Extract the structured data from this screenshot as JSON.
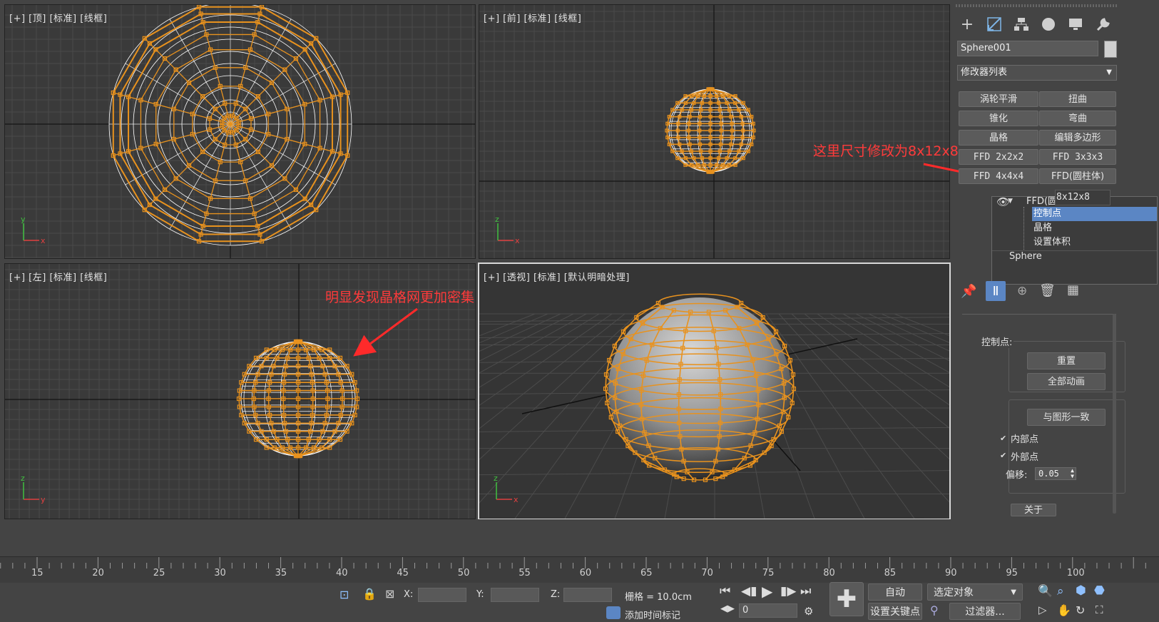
{
  "viewports": {
    "top_label": "[+] [顶] [标准] [线框]",
    "front_label": "[+] [前] [标准] [线框]",
    "left_label": "[+] [左] [标准] [线框]",
    "persp_label": "[+] [透视] [标准] [默认明暗处理]"
  },
  "annotations": {
    "size_note": "这里尺寸修改为8x12x8",
    "dense_note": "明显发现晶格网更加密集"
  },
  "panel": {
    "object_name": "Sphere001",
    "modifier_list": "修改器列表",
    "modifier_buttons": [
      "涡轮平滑",
      "扭曲",
      "锥化",
      "弯曲",
      "晶格",
      "编辑多边形",
      "FFD 2x2x2",
      "FFD 3x3x3",
      "FFD 4x4x4",
      "FFD(圆柱体)"
    ],
    "stack": {
      "ffd_label": "FFD(圆柱体)",
      "ffd_size": "8x12x8",
      "control_points": "控制点",
      "lattice": "晶格",
      "set_volume": "设置体积",
      "base": "Sphere"
    },
    "rollout": {
      "control_points_title": "控制点:",
      "reset": "重置",
      "animate_all": "全部动画",
      "conform": "与图形一致",
      "inside_points": "内部点",
      "outside_points": "外部点",
      "offset_label": "偏移:",
      "offset_value": "0.05",
      "about": "关于"
    }
  },
  "timeline": {
    "ticks": [
      "15",
      "20",
      "25",
      "30",
      "35",
      "40",
      "45",
      "50",
      "55",
      "60",
      "65",
      "70",
      "75",
      "80",
      "85",
      "90",
      "95",
      "100"
    ]
  },
  "status": {
    "x_label": "X:",
    "y_label": "Y:",
    "z_label": "Z:",
    "grid": "栅格 = 10.0cm",
    "add_time_tag": "添加时间标记",
    "auto": "自动",
    "selected_object": "选定对象",
    "set_key": "设置关键点",
    "filters": "过滤器...",
    "frame": "0"
  },
  "colors": {
    "wire_orange": "#e8921e",
    "viewport_bg": "#3a3a3a",
    "annotation_red": "#ff3a3a",
    "selection_blue": "#5b86c4"
  }
}
